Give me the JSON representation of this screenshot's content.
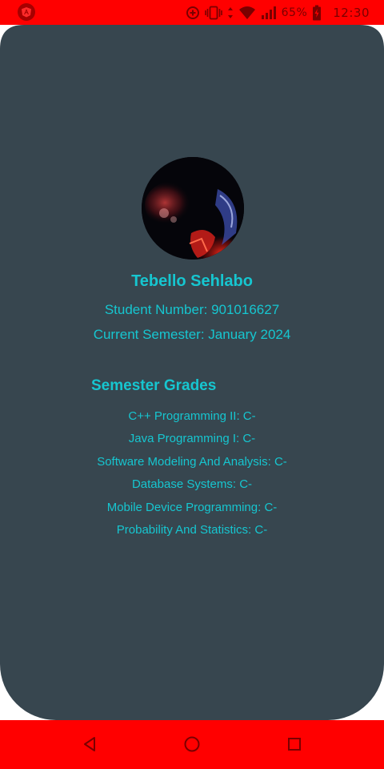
{
  "status_bar": {
    "battery_percent": "65%",
    "time": "12:30",
    "icons": [
      "angular-app-icon",
      "data-saver-icon",
      "vibrate-icon",
      "data-transfer-icon",
      "wifi-icon",
      "signal-icon",
      "battery-charging-icon"
    ]
  },
  "profile": {
    "name": "Tebello Sehlabo",
    "student_number": "Student Number: 901016627",
    "current_semester": "Current Semester: January 2024"
  },
  "grades": {
    "heading": "Semester Grades",
    "items": [
      "C++ Programming II: C-",
      "Java Programming I: C-",
      "Software Modeling And Analysis: C-",
      "Database Systems: C-",
      "Mobile Device Programming: C-",
      "Probability And Statistics: C-"
    ]
  },
  "nav_bar": {
    "icons": [
      "back-icon",
      "home-icon",
      "recents-icon"
    ]
  },
  "colors": {
    "status_bar": "#ff0000",
    "card_background": "#37464f",
    "accent_text": "#16c6d0",
    "page_background": "#ffffff"
  }
}
